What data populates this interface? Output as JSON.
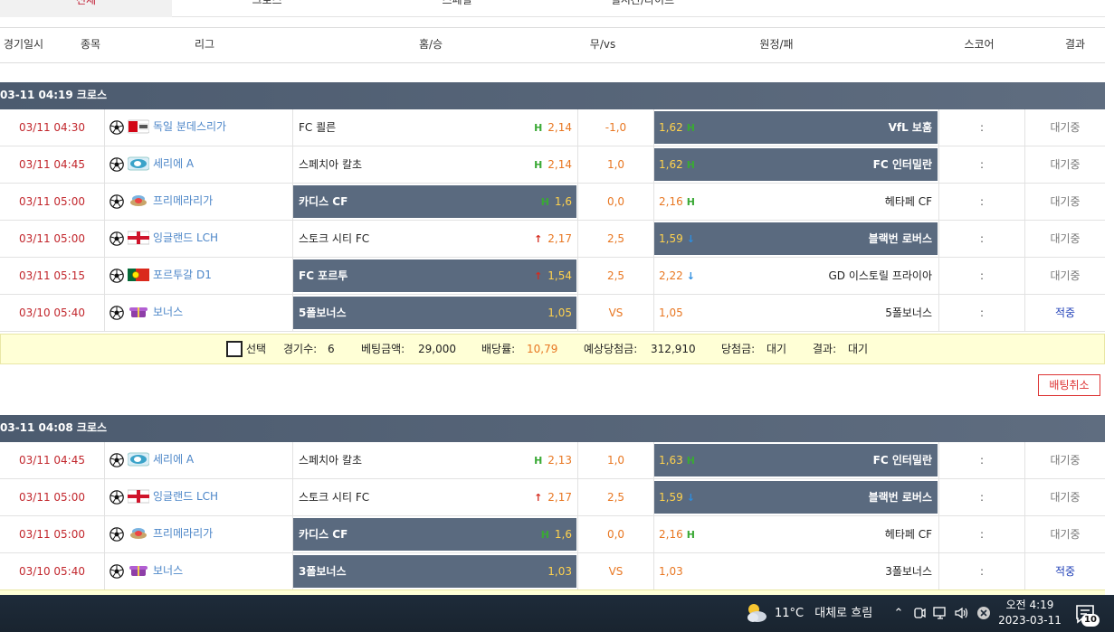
{
  "tabs": [
    {
      "label": "전체",
      "active": true
    },
    {
      "label": "크로스",
      "active": false
    },
    {
      "label": "스페셜",
      "active": false
    },
    {
      "label": "실시간/라이브",
      "active": false
    }
  ],
  "columns": [
    "경기일시",
    "종목",
    "리그",
    "홈/승",
    "무/vs",
    "원정/패",
    "스코어",
    "결과"
  ],
  "groups": [
    {
      "header": "03-11 04:19 크로스",
      "rows": [
        {
          "time": "03/11 04:30",
          "league": "독일 분데스리가",
          "flag": "bundesliga-flag-icon",
          "home": "FC 쾰른",
          "home_ind": "H",
          "home_odd": "2,14",
          "draw": "-1,0",
          "away_odd": "1,62",
          "away_ind": "H",
          "away": "VfL 보훔",
          "score": ":",
          "result": "대기중",
          "sel": "away"
        },
        {
          "time": "03/11 04:45",
          "league": "세리에 A",
          "flag": "serie-a-flag-icon",
          "home": "스페치아 칼초",
          "home_ind": "H",
          "home_odd": "2,14",
          "draw": "1,0",
          "away_odd": "1,62",
          "away_ind": "H",
          "away": "FC 인터밀란",
          "score": ":",
          "result": "대기중",
          "sel": "away"
        },
        {
          "time": "03/11 05:00",
          "league": "프리메라리가",
          "flag": "laliga-flag-icon",
          "home": "카디스 CF",
          "home_ind": "H",
          "home_odd": "1,6",
          "draw": "0,0",
          "away_odd": "2,16",
          "away_ind": "H",
          "away": "헤타페 CF",
          "score": ":",
          "result": "대기중",
          "sel": "home"
        },
        {
          "time": "03/11 05:00",
          "league": "잉글랜드 LCH",
          "flag": "england-flag-icon",
          "home": "스토크 시티 FC",
          "home_ind": "↑",
          "home_odd": "2,17",
          "draw": "2,5",
          "away_odd": "1,59",
          "away_ind": "↓",
          "away": "블랙번 로버스",
          "score": ":",
          "result": "대기중",
          "sel": "away"
        },
        {
          "time": "03/11 05:15",
          "league": "포르투갈 D1",
          "flag": "portugal-flag-icon",
          "home": "FC 포르투",
          "home_ind": "↑",
          "home_odd": "1,54",
          "draw": "2,5",
          "away_odd": "2,22",
          "away_ind": "↓",
          "away": "GD 이스토릴 프라이아",
          "score": ":",
          "result": "대기중",
          "sel": "home"
        },
        {
          "time": "03/10 05:40",
          "league": "보너스",
          "flag": "bonus-icon",
          "home": "5폴보너스",
          "home_ind": "",
          "home_odd": "1,05",
          "draw": "VS",
          "away_odd": "1,05",
          "away_ind": "",
          "away": "5폴보너스",
          "score": ":",
          "result": "적중",
          "sel": "home"
        }
      ]
    },
    {
      "header": "03-11 04:08 크로스",
      "rows": [
        {
          "time": "03/11 04:45",
          "league": "세리에 A",
          "flag": "serie-a-flag-icon",
          "home": "스페치아 칼초",
          "home_ind": "H",
          "home_odd": "2,13",
          "draw": "1,0",
          "away_odd": "1,63",
          "away_ind": "H",
          "away": "FC 인터밀란",
          "score": ":",
          "result": "대기중",
          "sel": "away"
        },
        {
          "time": "03/11 05:00",
          "league": "잉글랜드 LCH",
          "flag": "england-flag-icon",
          "home": "스토크 시티 FC",
          "home_ind": "↑",
          "home_odd": "2,17",
          "draw": "2,5",
          "away_odd": "1,59",
          "away_ind": "↓",
          "away": "블랙번 로버스",
          "score": ":",
          "result": "대기중",
          "sel": "away"
        },
        {
          "time": "03/11 05:00",
          "league": "프리메라리가",
          "flag": "laliga-flag-icon",
          "home": "카디스 CF",
          "home_ind": "H",
          "home_odd": "1,6",
          "draw": "0,0",
          "away_odd": "2,16",
          "away_ind": "H",
          "away": "헤타페 CF",
          "score": ":",
          "result": "대기중",
          "sel": "home"
        },
        {
          "time": "03/10 05:40",
          "league": "보너스",
          "flag": "bonus-icon",
          "home": "3폴보너스",
          "home_ind": "",
          "home_odd": "1,03",
          "draw": "VS",
          "away_odd": "1,03",
          "away_ind": "",
          "away": "3폴보너스",
          "score": ":",
          "result": "적중",
          "sel": "home"
        }
      ]
    }
  ],
  "summary": {
    "select_label": "선택",
    "games_label": "경기수:",
    "games_value": "6",
    "bet_label": "베팅금액:",
    "bet_value": "29,000",
    "odds_label": "배당률:",
    "odds_value": "10,79",
    "expected_label": "예상당첨금:",
    "expected_value": "312,910",
    "prize_label": "당첨금:",
    "prize_value": "대기",
    "result_label": "결과:",
    "result_value": "대기"
  },
  "cancel_label": "배팅취소",
  "taskbar": {
    "temp": "11°C",
    "weather": "대체로 흐림",
    "time": "오전 4:19",
    "date": "2023-03-11",
    "notifications": "10"
  },
  "colors": {
    "accent": "#c0172e",
    "selected_bg": "#5a6a7f",
    "odds": "#e87722",
    "summary_bg": "#ffffd6"
  }
}
